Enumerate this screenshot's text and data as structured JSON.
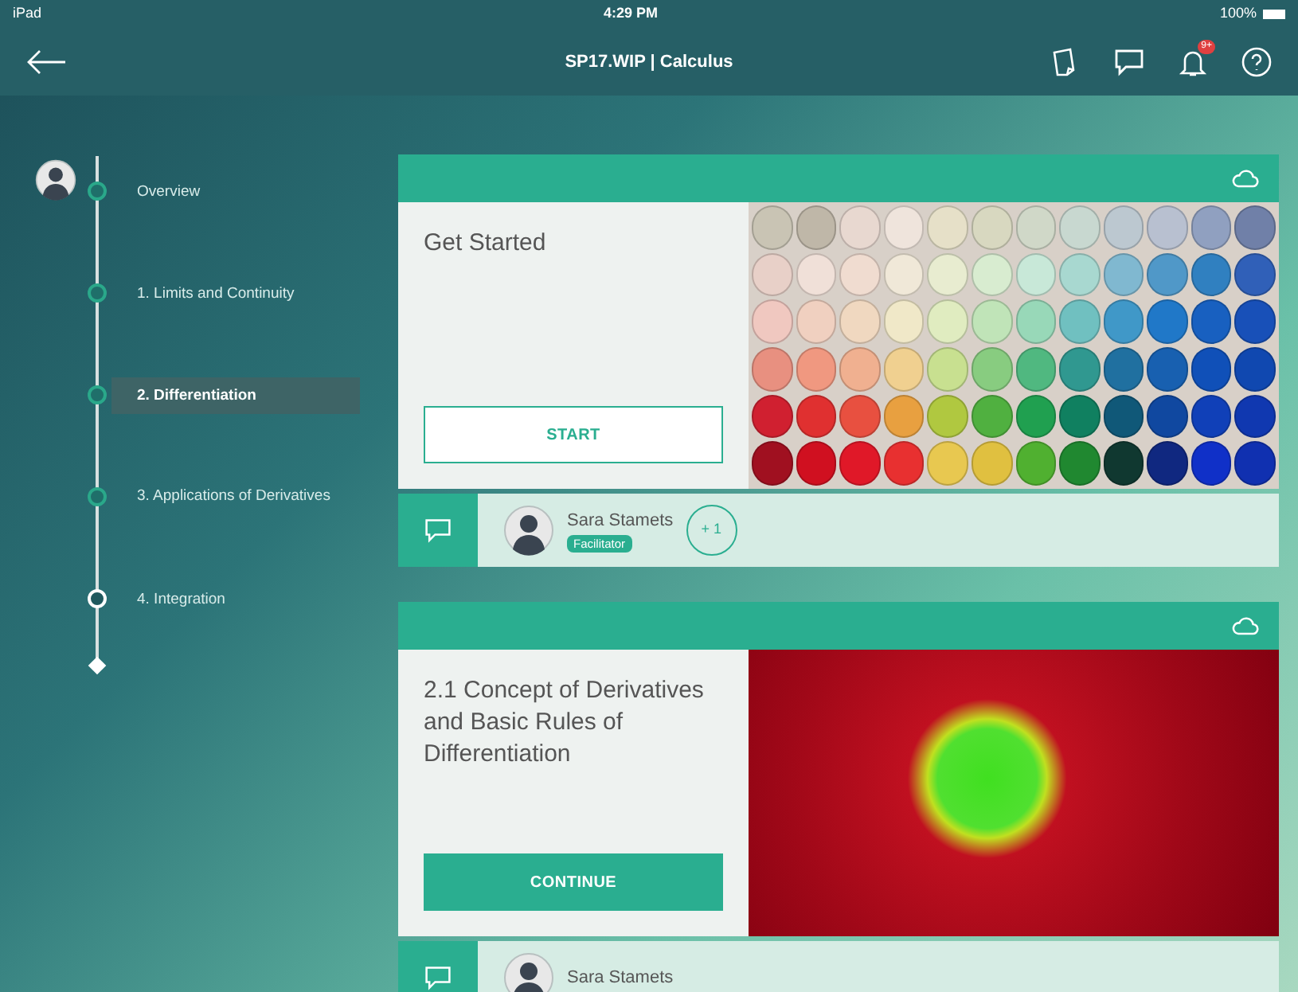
{
  "status_bar": {
    "device": "iPad",
    "time": "4:29 PM",
    "battery": "100%"
  },
  "header": {
    "title": "SP17.WIP | Calculus",
    "notification_badge": "9+"
  },
  "timeline": [
    {
      "label": "Overview",
      "selected": false,
      "complete": true
    },
    {
      "label": "1. Limits and Continuity",
      "selected": false,
      "complete": true
    },
    {
      "label": "2. Differentiation",
      "selected": true,
      "complete": true
    },
    {
      "label": "3. Applications of Derivatives",
      "selected": false,
      "complete": true
    },
    {
      "label": "4. Integration",
      "selected": false,
      "complete": false
    }
  ],
  "cards": [
    {
      "title": "Get Started",
      "button": "START",
      "button_filled": false,
      "kind": "plate",
      "person": "Sara Stamets",
      "role": "Facilitator",
      "extra": "+ 1"
    },
    {
      "title": "2.1 Concept of Derivatives and Basic Rules of Differentiation",
      "button": "CONTINUE",
      "button_filled": true,
      "kind": "dish",
      "person": "Sara Stamets"
    }
  ]
}
